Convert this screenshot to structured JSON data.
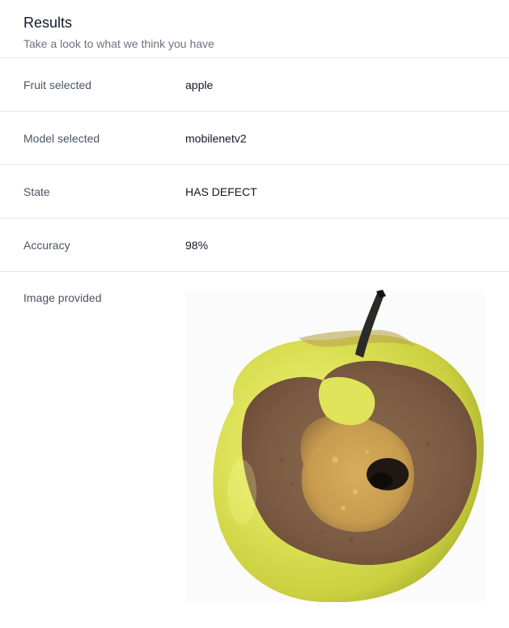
{
  "header": {
    "title": "Results",
    "subtitle": "Take a look to what we think you have"
  },
  "rows": [
    {
      "label": "Fruit selected",
      "value": "apple"
    },
    {
      "label": "Model selected",
      "value": "mobilenetv2"
    },
    {
      "label": "State",
      "value": "HAS DEFECT"
    },
    {
      "label": "Accuracy",
      "value": "98%"
    }
  ],
  "image_row": {
    "label": "Image provided",
    "image_subject": "apple-with-rot-photo"
  },
  "colors": {
    "divider": "#e5e7eb",
    "label": "#4b5563",
    "subtitle": "#6b7280",
    "text": "#111827"
  }
}
